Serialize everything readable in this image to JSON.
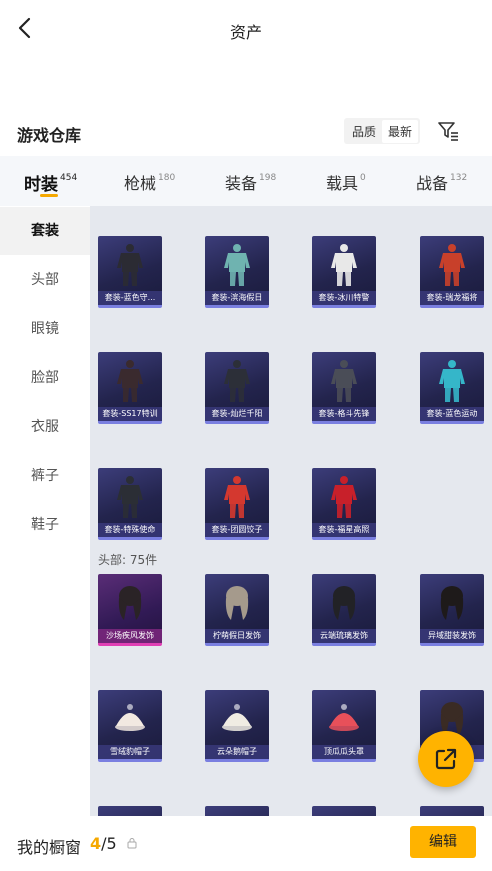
{
  "header": {
    "title": "资产"
  },
  "warehouse": {
    "title": "游戏仓库",
    "sort_options": [
      "品质",
      "最新"
    ],
    "active_sort": "最新"
  },
  "tabs": [
    {
      "label": "时装",
      "count": "454",
      "active": true
    },
    {
      "label": "枪械",
      "count": "180",
      "active": false
    },
    {
      "label": "装备",
      "count": "198",
      "active": false
    },
    {
      "label": "载具",
      "count": "0",
      "active": false
    },
    {
      "label": "战备",
      "count": "132",
      "active": false
    }
  ],
  "sidebar": {
    "items": [
      {
        "label": "套装",
        "active": true
      },
      {
        "label": "头部",
        "active": false
      },
      {
        "label": "眼镜",
        "active": false
      },
      {
        "label": "脸部",
        "active": false
      },
      {
        "label": "衣服",
        "active": false
      },
      {
        "label": "裤子",
        "active": false
      },
      {
        "label": "鞋子",
        "active": false
      }
    ]
  },
  "sets": [
    {
      "label": "套装-蓝色守...",
      "art": "dark-outfit",
      "color": "#2b2b33"
    },
    {
      "label": "套装-滨海假日",
      "art": "teal-outfit",
      "color": "#6fb3b0"
    },
    {
      "label": "套装-冰川特警",
      "art": "white-outfit",
      "color": "#e8e8e8"
    },
    {
      "label": "套装-瑞龙福将",
      "art": "red-outfit",
      "color": "#c8402a"
    },
    {
      "label": "套装-SS17特训",
      "art": "dark-red-outfit",
      "color": "#3a2a2e"
    },
    {
      "label": "套装-灿烂千阳",
      "art": "suit-outfit",
      "color": "#2c2f38"
    },
    {
      "label": "套装-格斗先锋",
      "art": "grey-outfit",
      "color": "#4a4d57"
    },
    {
      "label": "套装-蓝色运动",
      "art": "cyan-outfit",
      "color": "#35b6c9"
    },
    {
      "label": "套装-特殊使命",
      "art": "dark-outfit",
      "color": "#2b2e35"
    },
    {
      "label": "套装-团圆饺子",
      "art": "festive-outfit",
      "color": "#d4382f"
    },
    {
      "label": "套装-福星高照",
      "art": "red-outfit",
      "color": "#c8202a"
    }
  ],
  "head_section": {
    "label": "头部: 75件"
  },
  "heads": [
    {
      "label": "沙场疾风发饰",
      "art": "hair",
      "color": "#2a2326",
      "rarity": "pink"
    },
    {
      "label": "柠萌假日发饰",
      "art": "hair",
      "color": "#a59a8c",
      "rarity": "blue"
    },
    {
      "label": "云端琉璃发饰",
      "art": "hair",
      "color": "#222226",
      "rarity": "blue"
    },
    {
      "label": "异域甜装发饰",
      "art": "hair",
      "color": "#1e1a1a",
      "rarity": "blue"
    },
    {
      "label": "雪绒豹帽子",
      "art": "hat",
      "color": "#f2e9e1",
      "rarity": "blue"
    },
    {
      "label": "云朵鹅帽子",
      "art": "hat",
      "color": "#f0ece3",
      "rarity": "blue"
    },
    {
      "label": "顶瓜瓜头罩",
      "art": "hat",
      "color": "#e8505a",
      "rarity": "blue"
    },
    {
      "label": "",
      "art": "hair",
      "color": "#3a2b24",
      "rarity": "blue"
    }
  ],
  "footer": {
    "showcase_label": "我的橱窗",
    "count_current": "4",
    "count_total": "/5",
    "edit_label": "编辑"
  },
  "colors": {
    "accent": "#ffb300",
    "tab_underline": "#f5a800",
    "rarity_blue": "#7a7fe0",
    "rarity_pink": "#e03fb4"
  }
}
